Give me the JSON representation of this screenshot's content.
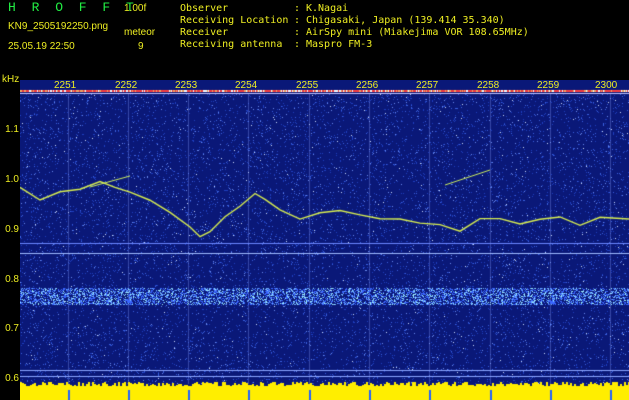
{
  "header": {
    "app_title": "H R O F F T",
    "version": "1.00f",
    "file_name": "KN9_2505192250.png",
    "meteor_label": "meteor",
    "datetime": "25.05.19 22:50",
    "meteor_count": "9"
  },
  "info": [
    {
      "label": "Observer",
      "value": "K.Nagai"
    },
    {
      "label": "Receiving Location",
      "value": "Chigasaki, Japan (139.414 35.340)"
    },
    {
      "label": "Receiver",
      "value": "AirSpy mini (Miakejima VOR 108.65MHz)"
    },
    {
      "label": "Receiving antenna",
      "value": "Maspro FM-3"
    }
  ],
  "axis": {
    "unit": "kHz",
    "time_labels": [
      "2251",
      "2252",
      "2253",
      "2254",
      "2255",
      "2256",
      "2257",
      "2258",
      "2259",
      "2300"
    ],
    "freq_labels": [
      "1.1",
      "1.0",
      "0.9",
      "0.8",
      "0.7",
      "0.6"
    ]
  },
  "colors": {
    "background": "#000000",
    "text": "#eeee22",
    "title": "#22ee44",
    "spectrum_base": "#0a1a8a",
    "trace": "#ddee44",
    "bottom_bar": "#ffee00"
  }
}
